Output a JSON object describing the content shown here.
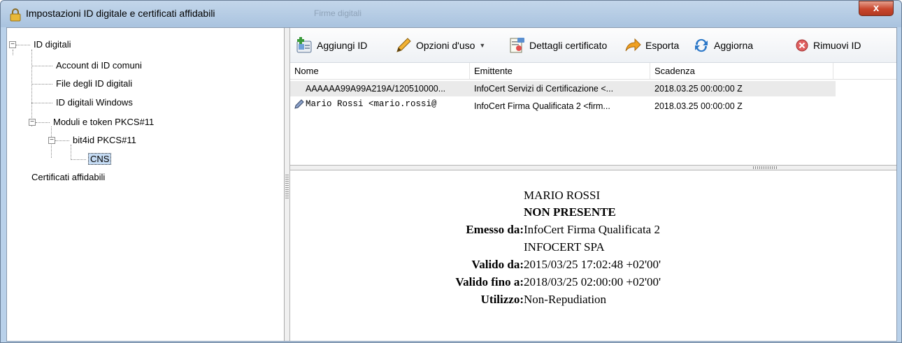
{
  "window": {
    "title": "Impostazioni ID digitale e certificati affidabili",
    "background_title": "Firme digitali",
    "close_label": "x"
  },
  "tree": {
    "items": [
      {
        "label": "ID digitali",
        "level": 0,
        "expanded": true
      },
      {
        "label": "Account di ID comuni",
        "level": 1
      },
      {
        "label": "File degli ID digitali",
        "level": 1
      },
      {
        "label": "ID digitali Windows",
        "level": 1
      },
      {
        "label": "Moduli e token PKCS#11",
        "level": 1,
        "expanded": true
      },
      {
        "label": "bit4id PKCS#11",
        "level": 2,
        "expanded": true
      },
      {
        "label": "CNS",
        "level": 3,
        "selected": true
      },
      {
        "label": "Certificati affidabili",
        "level": 0
      }
    ]
  },
  "toolbar": {
    "add_id": "Aggiungi ID",
    "usage_options": "Opzioni d'uso",
    "cert_details": "Dettagli certificato",
    "export": "Esporta",
    "refresh": "Aggiorna",
    "remove_id": "Rimuovi ID"
  },
  "list": {
    "columns": [
      "Nome",
      "Emittente",
      "Scadenza"
    ],
    "rows": [
      {
        "name": "AAAAAA99A99A219A/120510000...",
        "issuer": "InfoCert Servizi di Certificazione <...",
        "expiry": "2018.03.25 00:00:00 Z"
      },
      {
        "name": "Mario Rossi <mario.rossi@",
        "issuer": "InfoCert Firma Qualificata 2 <firm...",
        "expiry": "2018.03.25 00:00:00 Z"
      }
    ]
  },
  "details": {
    "name": "MARIO ROSSI",
    "subtitle": "NON PRESENTE",
    "issued_by_label": "Emesso da:",
    "issued_by_value": "InfoCert Firma Qualificata 2",
    "issued_by_org": "INFOCERT SPA",
    "valid_from_label": "Valido da:",
    "valid_from_value": "2015/03/25 17:02:48 +02'00'",
    "valid_to_label": "Valido fino a:",
    "valid_to_value": "2018/03/25 02:00:00 +02'00'",
    "usage_label": "Utilizzo:",
    "usage_value": "Non-Repudiation"
  },
  "colors": {
    "selection": "#c4daf2",
    "window_frame": "#b9d1ea",
    "close_button": "#c8462d"
  }
}
